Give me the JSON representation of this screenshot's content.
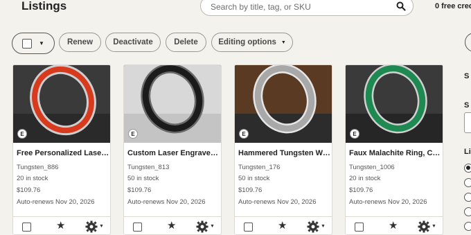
{
  "header": {
    "title": "Listings",
    "search_placeholder": "Search by title, tag, or SKU",
    "credits_text": "0 free cred"
  },
  "toolbar": {
    "renew": "Renew",
    "deactivate": "Deactivate",
    "delete": "Delete",
    "editing_options": "Editing options"
  },
  "listings": [
    {
      "title": "Free Personalized Laser ...",
      "sku": "Tungsten_886",
      "stock": "20 in stock",
      "price": "$109.76",
      "renew": "Auto-renews Nov 20, 2026",
      "badge": "E",
      "accent": "#d83a1e"
    },
    {
      "title": "Custom Laser Engraved ...",
      "sku": "Tungsten_813",
      "stock": "50 in stock",
      "price": "$109.76",
      "renew": "Auto-renews Nov 20, 2026",
      "badge": "E",
      "accent": "#1b1b1b"
    },
    {
      "title": "Hammered Tungsten We...",
      "sku": "Tungsten_176",
      "stock": "50 in stock",
      "price": "$109.76",
      "renew": "Auto-renews Nov 20, 2026",
      "badge": "E",
      "accent": "#a8a8a8"
    },
    {
      "title": "Faux Malachite Ring, Cu...",
      "sku": "Tungsten_1006",
      "stock": "20 in stock",
      "price": "$109.76",
      "renew": "Auto-renews Nov 20, 2026",
      "badge": "E",
      "accent": "#1e8a52"
    }
  ],
  "right_panel": {
    "s1": "S",
    "s2": "S",
    "li": "Li"
  },
  "colors": {
    "background": "#f4f2ed",
    "card": "#ffffff",
    "border": "#dcd9d2",
    "text": "#222222"
  },
  "icons": {
    "search": "search-icon",
    "star": "star-icon",
    "gear": "gear-icon",
    "caret": "caret-down-icon"
  }
}
